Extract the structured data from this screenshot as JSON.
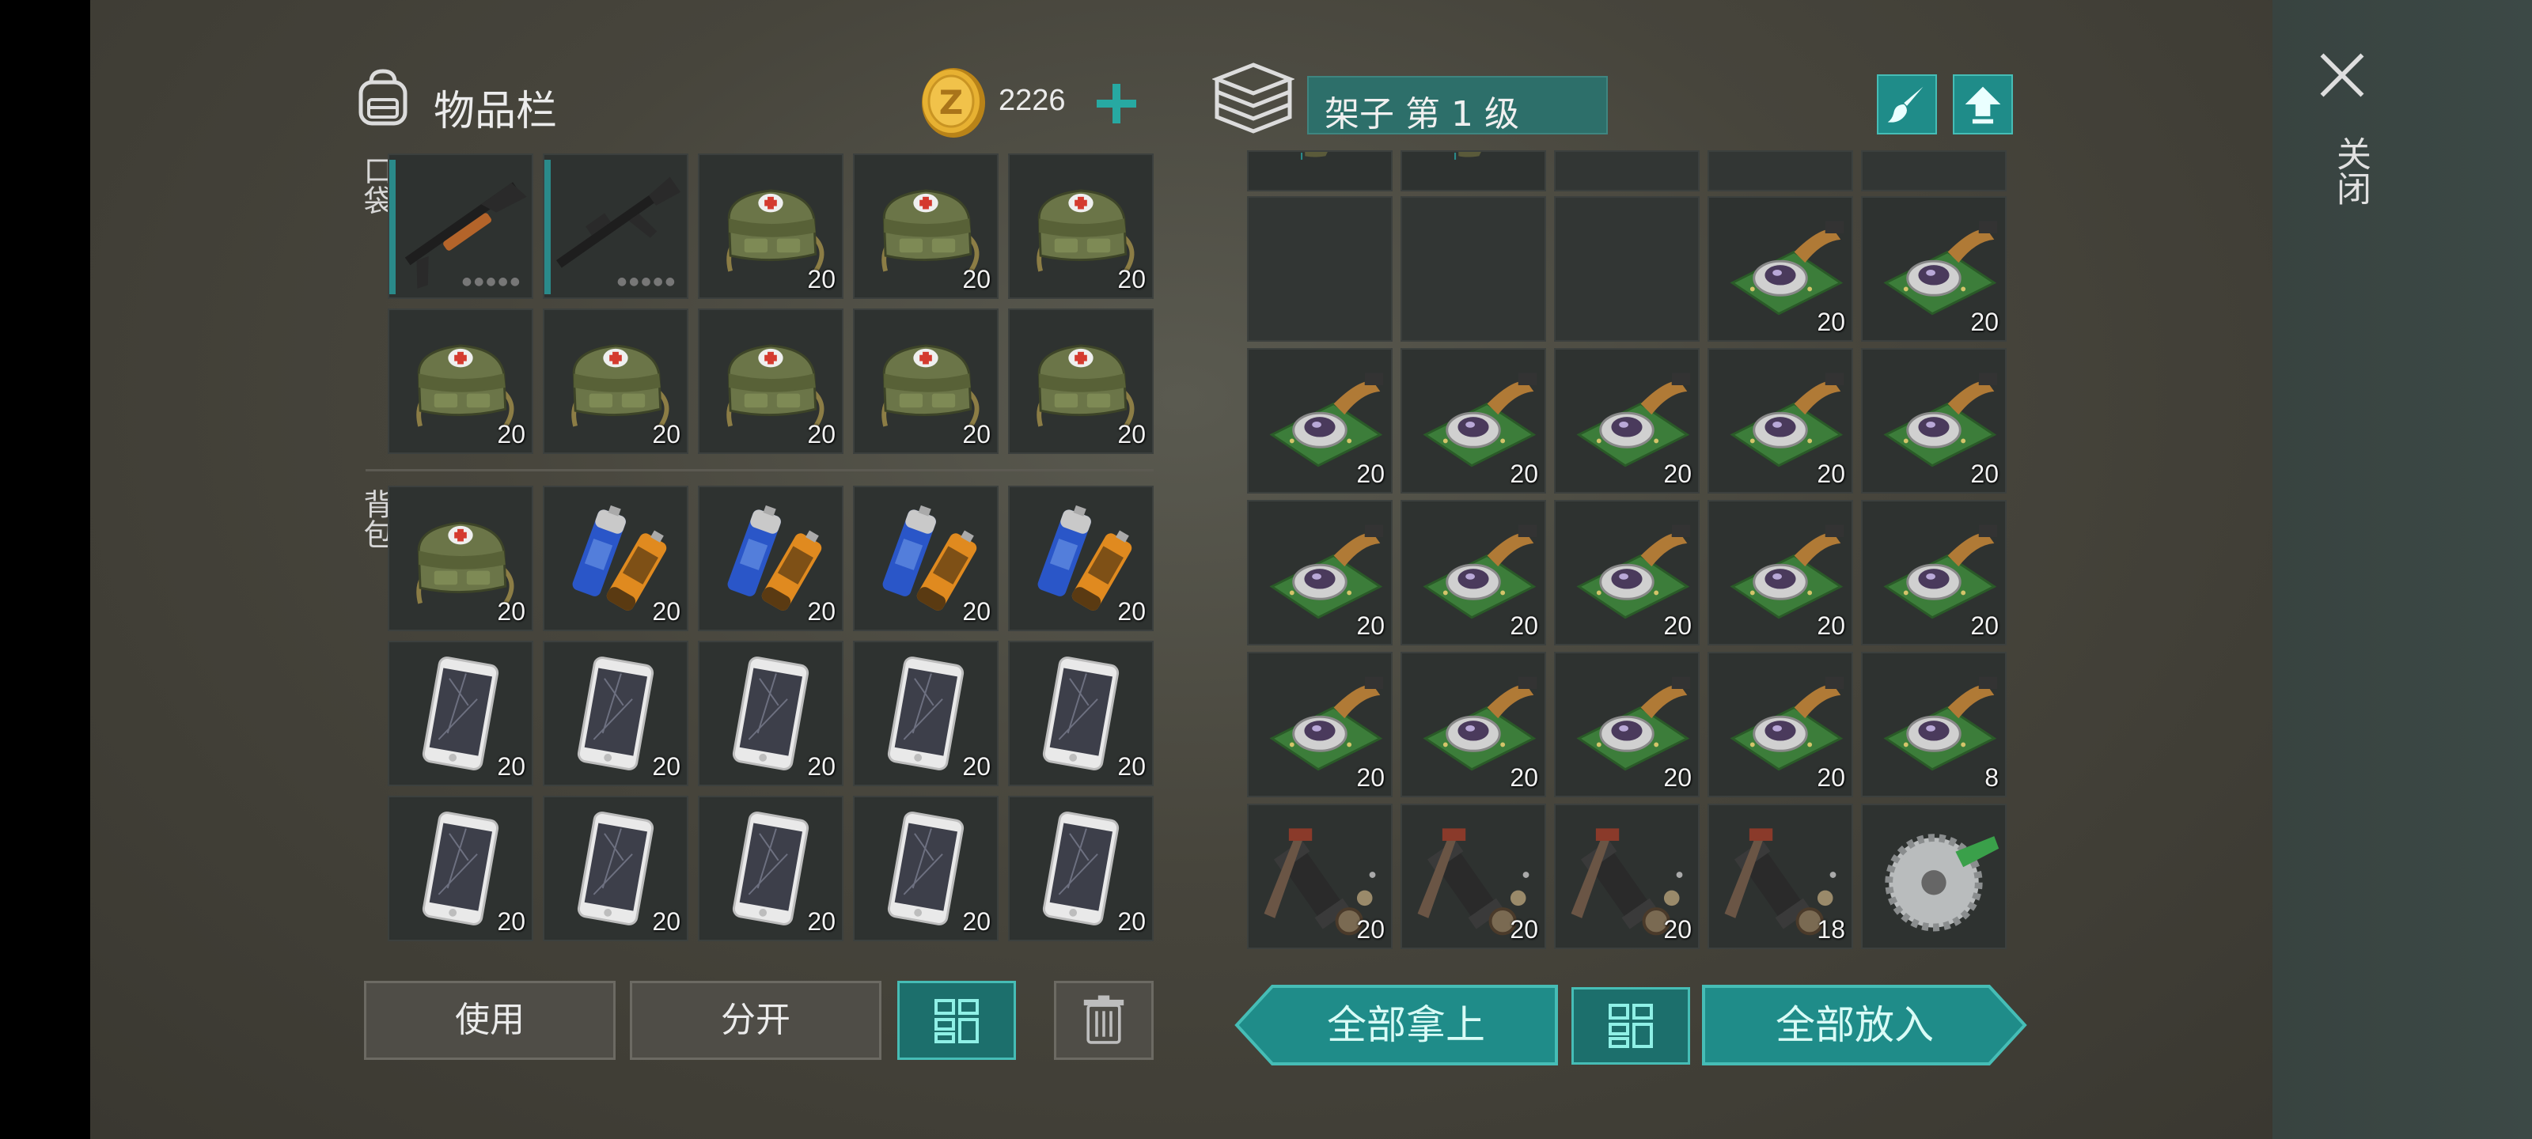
{
  "inventory": {
    "title": "物品栏",
    "coins": "2226",
    "pocket_label": "口袋",
    "backpack_label": "背包",
    "pocket_slots": [
      {
        "item": "shotgun",
        "count": ""
      },
      {
        "item": "rifle",
        "count": ""
      },
      {
        "item": "medkit",
        "count": "20"
      },
      {
        "item": "medkit",
        "count": "20"
      },
      {
        "item": "medkit",
        "count": "20"
      },
      {
        "item": "medkit",
        "count": "20"
      },
      {
        "item": "medkit",
        "count": "20"
      },
      {
        "item": "medkit",
        "count": "20"
      },
      {
        "item": "medkit",
        "count": "20"
      },
      {
        "item": "medkit",
        "count": "20"
      }
    ],
    "backpack_slots": [
      {
        "item": "medkit",
        "count": "20"
      },
      {
        "item": "batteries",
        "count": "20"
      },
      {
        "item": "batteries",
        "count": "20"
      },
      {
        "item": "batteries",
        "count": "20"
      },
      {
        "item": "batteries",
        "count": "20"
      },
      {
        "item": "phone",
        "count": "20"
      },
      {
        "item": "phone",
        "count": "20"
      },
      {
        "item": "phone",
        "count": "20"
      },
      {
        "item": "phone",
        "count": "20"
      },
      {
        "item": "phone",
        "count": "20"
      },
      {
        "item": "phone",
        "count": "20"
      },
      {
        "item": "phone",
        "count": "20"
      },
      {
        "item": "phone",
        "count": "20"
      },
      {
        "item": "phone",
        "count": "20"
      },
      {
        "item": "phone",
        "count": "20"
      }
    ],
    "buttons": {
      "use": "使用",
      "split": "分开"
    }
  },
  "storage": {
    "title": "架子 第 1 级",
    "top_partial_slots": [
      {
        "item": "partial"
      },
      {
        "item": "partial"
      },
      {
        "item": "empty"
      },
      {
        "item": "empty"
      },
      {
        "item": "empty"
      }
    ],
    "slots": [
      {
        "item": "empty",
        "count": ""
      },
      {
        "item": "empty",
        "count": ""
      },
      {
        "item": "empty",
        "count": ""
      },
      {
        "item": "camera-module",
        "count": "20"
      },
      {
        "item": "camera-module",
        "count": "20"
      },
      {
        "item": "camera-module",
        "count": "20"
      },
      {
        "item": "camera-module",
        "count": "20"
      },
      {
        "item": "camera-module",
        "count": "20"
      },
      {
        "item": "camera-module",
        "count": "20"
      },
      {
        "item": "camera-module",
        "count": "20"
      },
      {
        "item": "camera-module",
        "count": "20"
      },
      {
        "item": "camera-module",
        "count": "20"
      },
      {
        "item": "camera-module",
        "count": "20"
      },
      {
        "item": "camera-module",
        "count": "20"
      },
      {
        "item": "camera-module",
        "count": "20"
      },
      {
        "item": "camera-module",
        "count": "20"
      },
      {
        "item": "camera-module",
        "count": "20"
      },
      {
        "item": "camera-module",
        "count": "20"
      },
      {
        "item": "camera-module",
        "count": "20"
      },
      {
        "item": "camera-module",
        "count": "8"
      },
      {
        "item": "scope-parts",
        "count": "20"
      },
      {
        "item": "scope-parts",
        "count": "20"
      },
      {
        "item": "scope-parts",
        "count": "20"
      },
      {
        "item": "scope-parts",
        "count": "18"
      },
      {
        "item": "saw-blade",
        "count": ""
      }
    ],
    "buttons": {
      "take_all": "全部拿上",
      "put_all": "全部放入"
    }
  },
  "close_label": "关闭",
  "colors": {
    "teal": "#1f8c89",
    "teal_border": "#46bdb6",
    "slot_bg": "#2e3230",
    "coin": "#e0a92a"
  },
  "icons": [
    "backpack-icon",
    "coin-icon",
    "plus-icon",
    "shelf-icon",
    "brush-icon",
    "upgrade-arrow-icon",
    "close-icon",
    "grid-icon",
    "trash-icon"
  ]
}
